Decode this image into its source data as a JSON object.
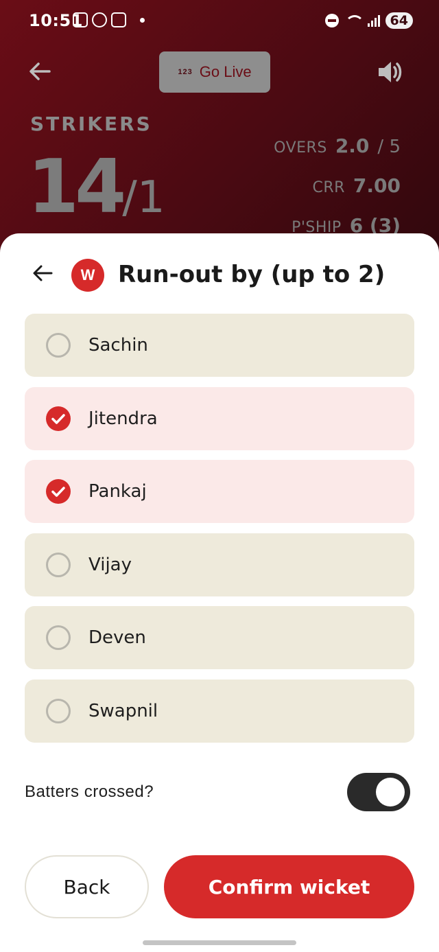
{
  "status_bar": {
    "time": "10:51",
    "battery": "64",
    "icons": [
      "screenshot-icon",
      "pinwheel-icon",
      "instagram-icon",
      "notification-dot-icon",
      "dnd-icon",
      "wifi-icon",
      "signal-icon"
    ]
  },
  "background_screen": {
    "go_live_badge": "123",
    "go_live_label": "Go Live",
    "team_name": "STRIKERS",
    "score_runs": "14",
    "score_wickets": "/1",
    "overs_label": "OVERS",
    "overs_value": "2.0",
    "overs_total": "/ 5",
    "crr_label": "CRR",
    "crr_value": "7.00",
    "pship_label": "P'SHIP",
    "pship_value": "6 (3)"
  },
  "sheet": {
    "badge": "W",
    "title": "Run-out by (up to 2)",
    "players": [
      {
        "name": "Sachin",
        "selected": false
      },
      {
        "name": "Jitendra",
        "selected": true
      },
      {
        "name": "Pankaj",
        "selected": true
      },
      {
        "name": "Vijay",
        "selected": false
      },
      {
        "name": "Deven",
        "selected": false
      },
      {
        "name": "Swapnil",
        "selected": false
      }
    ],
    "toggle_label": "Batters crossed?",
    "toggle_on": true,
    "back_label": "Back",
    "confirm_label": "Confirm wicket"
  },
  "colors": {
    "accent": "#d62a2a",
    "selected_bg": "#fbe9e8",
    "unselected_bg": "#eeeadb",
    "header_bg": "#5a0b13"
  }
}
